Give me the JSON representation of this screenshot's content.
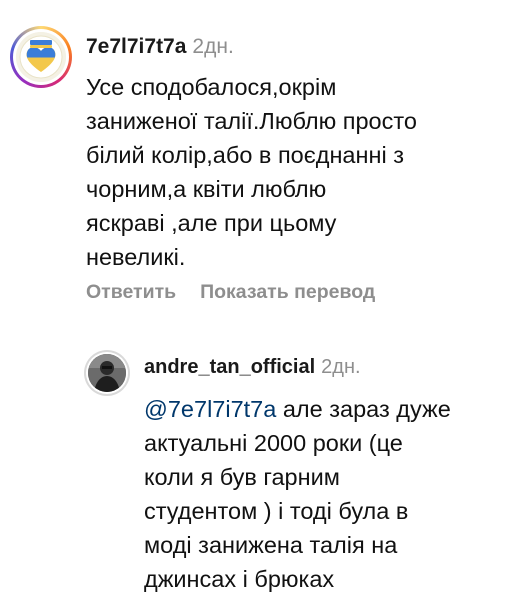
{
  "comment": {
    "username": "7e7l7i7t7a",
    "time": "2дн.",
    "lines": [
      "Усе сподобалося,окрім",
      "заниженої талії.Люблю просто",
      "білий колір,або в поєднанні з",
      "чорним,а квіти люблю",
      "яскраві ,але при цьому",
      "невеликі."
    ],
    "actions": {
      "reply": "Ответить",
      "translate": "Показать перевод"
    }
  },
  "reply": {
    "username": "andre_tan_official",
    "time": "2дн.",
    "mention": "@7e7l7i7t7a",
    "first_line_rest": " але зараз дуже",
    "lines": [
      "актуальні 2000 роки (це",
      "коли я був гарним",
      "студентом ) і тоді була в",
      "моді занижена талія на",
      "джинсах і брюках"
    ]
  },
  "colors": {
    "meta": "#8e8e8e",
    "mention": "#00376b",
    "text": "#111111"
  }
}
